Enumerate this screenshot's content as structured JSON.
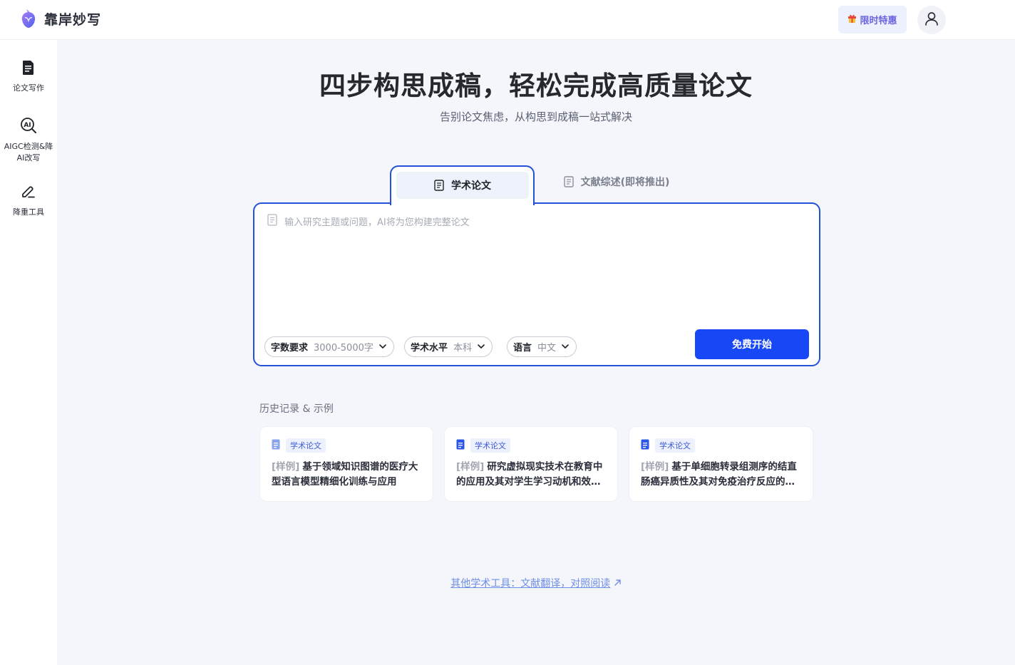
{
  "header": {
    "logo_text": "靠岸妙写",
    "promo_label": "限时特惠"
  },
  "sidebar": {
    "items": [
      {
        "label": "论文写作",
        "icon": "document-icon"
      },
      {
        "label": "AIGC检测&降AI改写",
        "icon": "ai-search-icon"
      },
      {
        "label": "降重工具",
        "icon": "pen-icon"
      }
    ]
  },
  "hero": {
    "title": "四步构思成稿，轻松完成高质量论文",
    "subtitle": "告别论文焦虑，从构思到成稿一站式解决"
  },
  "tabs": [
    {
      "label": "学术论文",
      "active": true
    },
    {
      "label": "文献综述(即将推出)",
      "active": false
    }
  ],
  "input": {
    "placeholder": "输入研究主题或问题，AI将为您构建完整论文"
  },
  "options": {
    "word_count": {
      "label": "字数要求",
      "value": "3000-5000字"
    },
    "level": {
      "label": "学术水平",
      "value": "本科"
    },
    "language": {
      "label": "语言",
      "value": "中文"
    }
  },
  "start_button": "免费开始",
  "history": {
    "title": "历史记录 & 示例",
    "items": [
      {
        "tag": "学术论文",
        "prefix": "[样例]",
        "text": "基于领域知识图谱的医疗大型语言模型精细化训练与应用"
      },
      {
        "tag": "学术论文",
        "prefix": "[样例]",
        "text": "研究虚拟现实技术在教育中的应用及其对学生学习动机和效果的影响"
      },
      {
        "tag": "学术论文",
        "prefix": "[样例]",
        "text": "基于单细胞转录组测序的结直肠癌异质性及其对免疫治疗反应的影响"
      }
    ]
  },
  "footer_link": "其他学术工具：文献翻译，对照阅读",
  "colors": {
    "primary": "#1848f5",
    "border_active": "#2352d9",
    "background": "#f4f6fb"
  }
}
